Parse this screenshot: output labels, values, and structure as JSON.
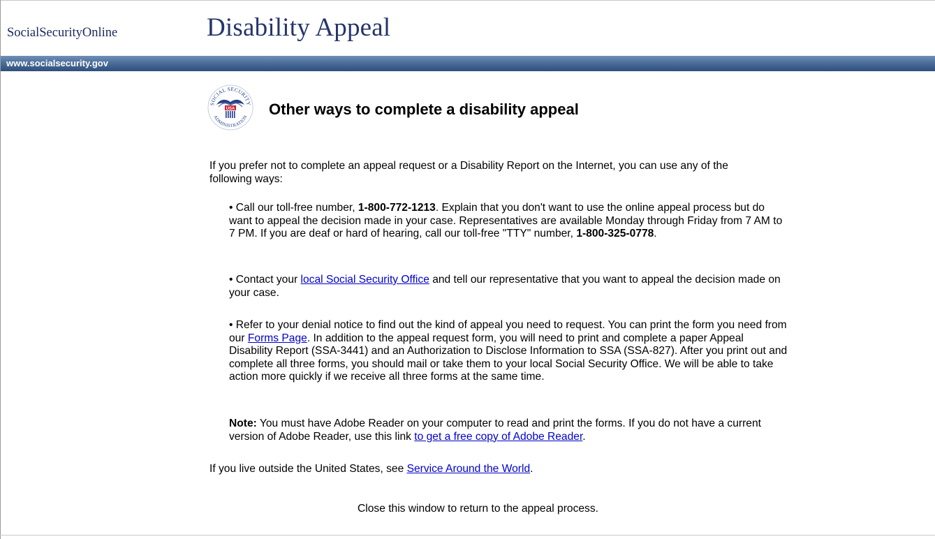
{
  "header": {
    "brand": "SocialSecurityOnline",
    "title": "Disability Appeal",
    "url": "www.socialsecurity.gov"
  },
  "logo": {
    "top_text": "SOCIAL SECURITY",
    "bottom_text": "ADMINISTRATION",
    "shield_text": "USA",
    "icon": "ssa-seal-icon"
  },
  "main": {
    "heading": "Other ways to complete a disability appeal",
    "intro": "If you prefer not to complete an appeal request or a Disability Report on the Internet, you can use any of the following ways:",
    "bullet1": {
      "a": "• Call our toll-free number, ",
      "phone": "1-800-772-1213",
      "b": ". Explain that you don't want to use the online appeal process but do want to appeal the decision made in your case. Representatives are available Monday through Friday from 7 AM to 7 PM. If you are deaf or hard of hearing, call our toll-free \"TTY\" number, ",
      "tty": "1-800-325-0778",
      "c": "."
    },
    "bullet2": {
      "a": "• Contact your ",
      "link": "local Social Security Office",
      "b": " and tell our representative that you want to appeal the decision made on your case."
    },
    "bullet3": {
      "a": "• Refer to your denial notice to find out the kind of appeal you need to request. You can print the form you need from our ",
      "link": "Forms Page",
      "b": ". In addition to the appeal request form, you will need to print and complete a paper Appeal Disability Report (SSA-3441) and an Authorization to Disclose Information to SSA (SSA-827). After you print out and complete all three forms, you should mail or take them to your local Social Security Office. We will be able to take action more quickly if we receive all three forms at the same time."
    },
    "note": {
      "label": "Note:",
      "a": " You must have Adobe Reader on your computer to read and print the forms. If you do not have a current version of Adobe Reader, use this link ",
      "link": "to get a free copy of Adobe Reader",
      "b": "."
    },
    "outside": {
      "a": "If you live outside the United States, see ",
      "link": "Service Around the World",
      "b": "."
    },
    "close_message": "Close this window to return to the appeal process."
  },
  "colors": {
    "title": "#25356b",
    "bar_top": "#6f8fb6",
    "bar_bottom": "#2e4f7c",
    "link": "#0000cc"
  }
}
